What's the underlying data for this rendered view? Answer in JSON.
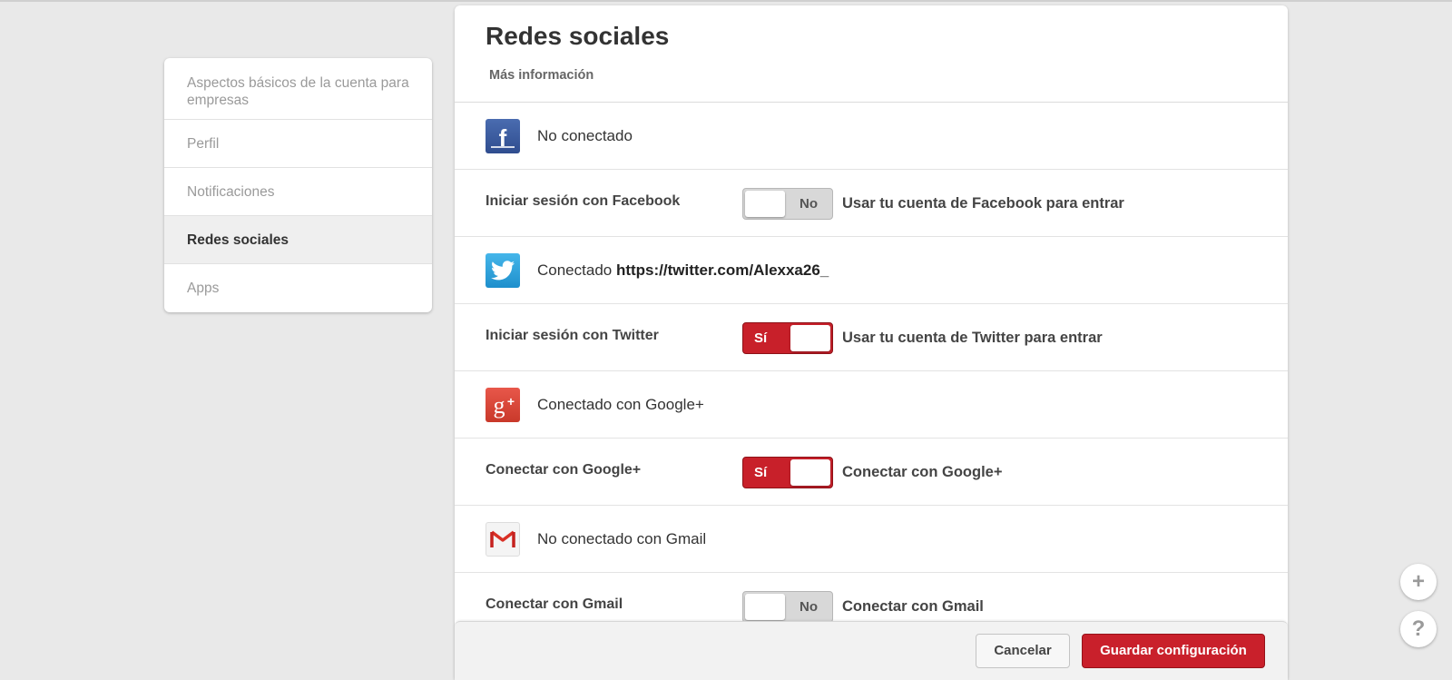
{
  "sidebar": {
    "items": [
      {
        "label": "Aspectos básicos de la cuenta para empresas"
      },
      {
        "label": "Perfil"
      },
      {
        "label": "Notificaciones"
      },
      {
        "label": "Redes sociales"
      },
      {
        "label": "Apps"
      }
    ]
  },
  "main": {
    "title": "Redes sociales",
    "more_info": "Más información",
    "facebook": {
      "status": "No conectado",
      "setting_label": "Iniciar sesión con Facebook",
      "toggle_label": "No",
      "description": "Usar tu cuenta de Facebook para entrar",
      "toggle_state": "off"
    },
    "twitter": {
      "status_prefix": "Conectado ",
      "link": "https://twitter.com/Alexxa26_",
      "setting_label": "Iniciar sesión con Twitter",
      "toggle_label": "Sí",
      "description": "Usar tu cuenta de Twitter para entrar",
      "toggle_state": "on"
    },
    "google": {
      "status": "Conectado con Google+",
      "setting_label": "Conectar con Google+",
      "toggle_label": "Sí",
      "description": "Conectar con Google+",
      "toggle_state": "on"
    },
    "gmail": {
      "status": "No conectado con Gmail",
      "setting_label": "Conectar con Gmail",
      "toggle_label": "No",
      "description": "Conectar con Gmail",
      "toggle_state": "off"
    }
  },
  "footer": {
    "cancel_label": "Cancelar",
    "save_label": "Guardar configuración"
  },
  "floating": {
    "plus": "+",
    "help": "?"
  },
  "colors": {
    "accent_red": "#c9202b",
    "facebook_blue": "#3b5b9e",
    "twitter_blue": "#2ea3dd",
    "google_red": "#dd4b39"
  }
}
